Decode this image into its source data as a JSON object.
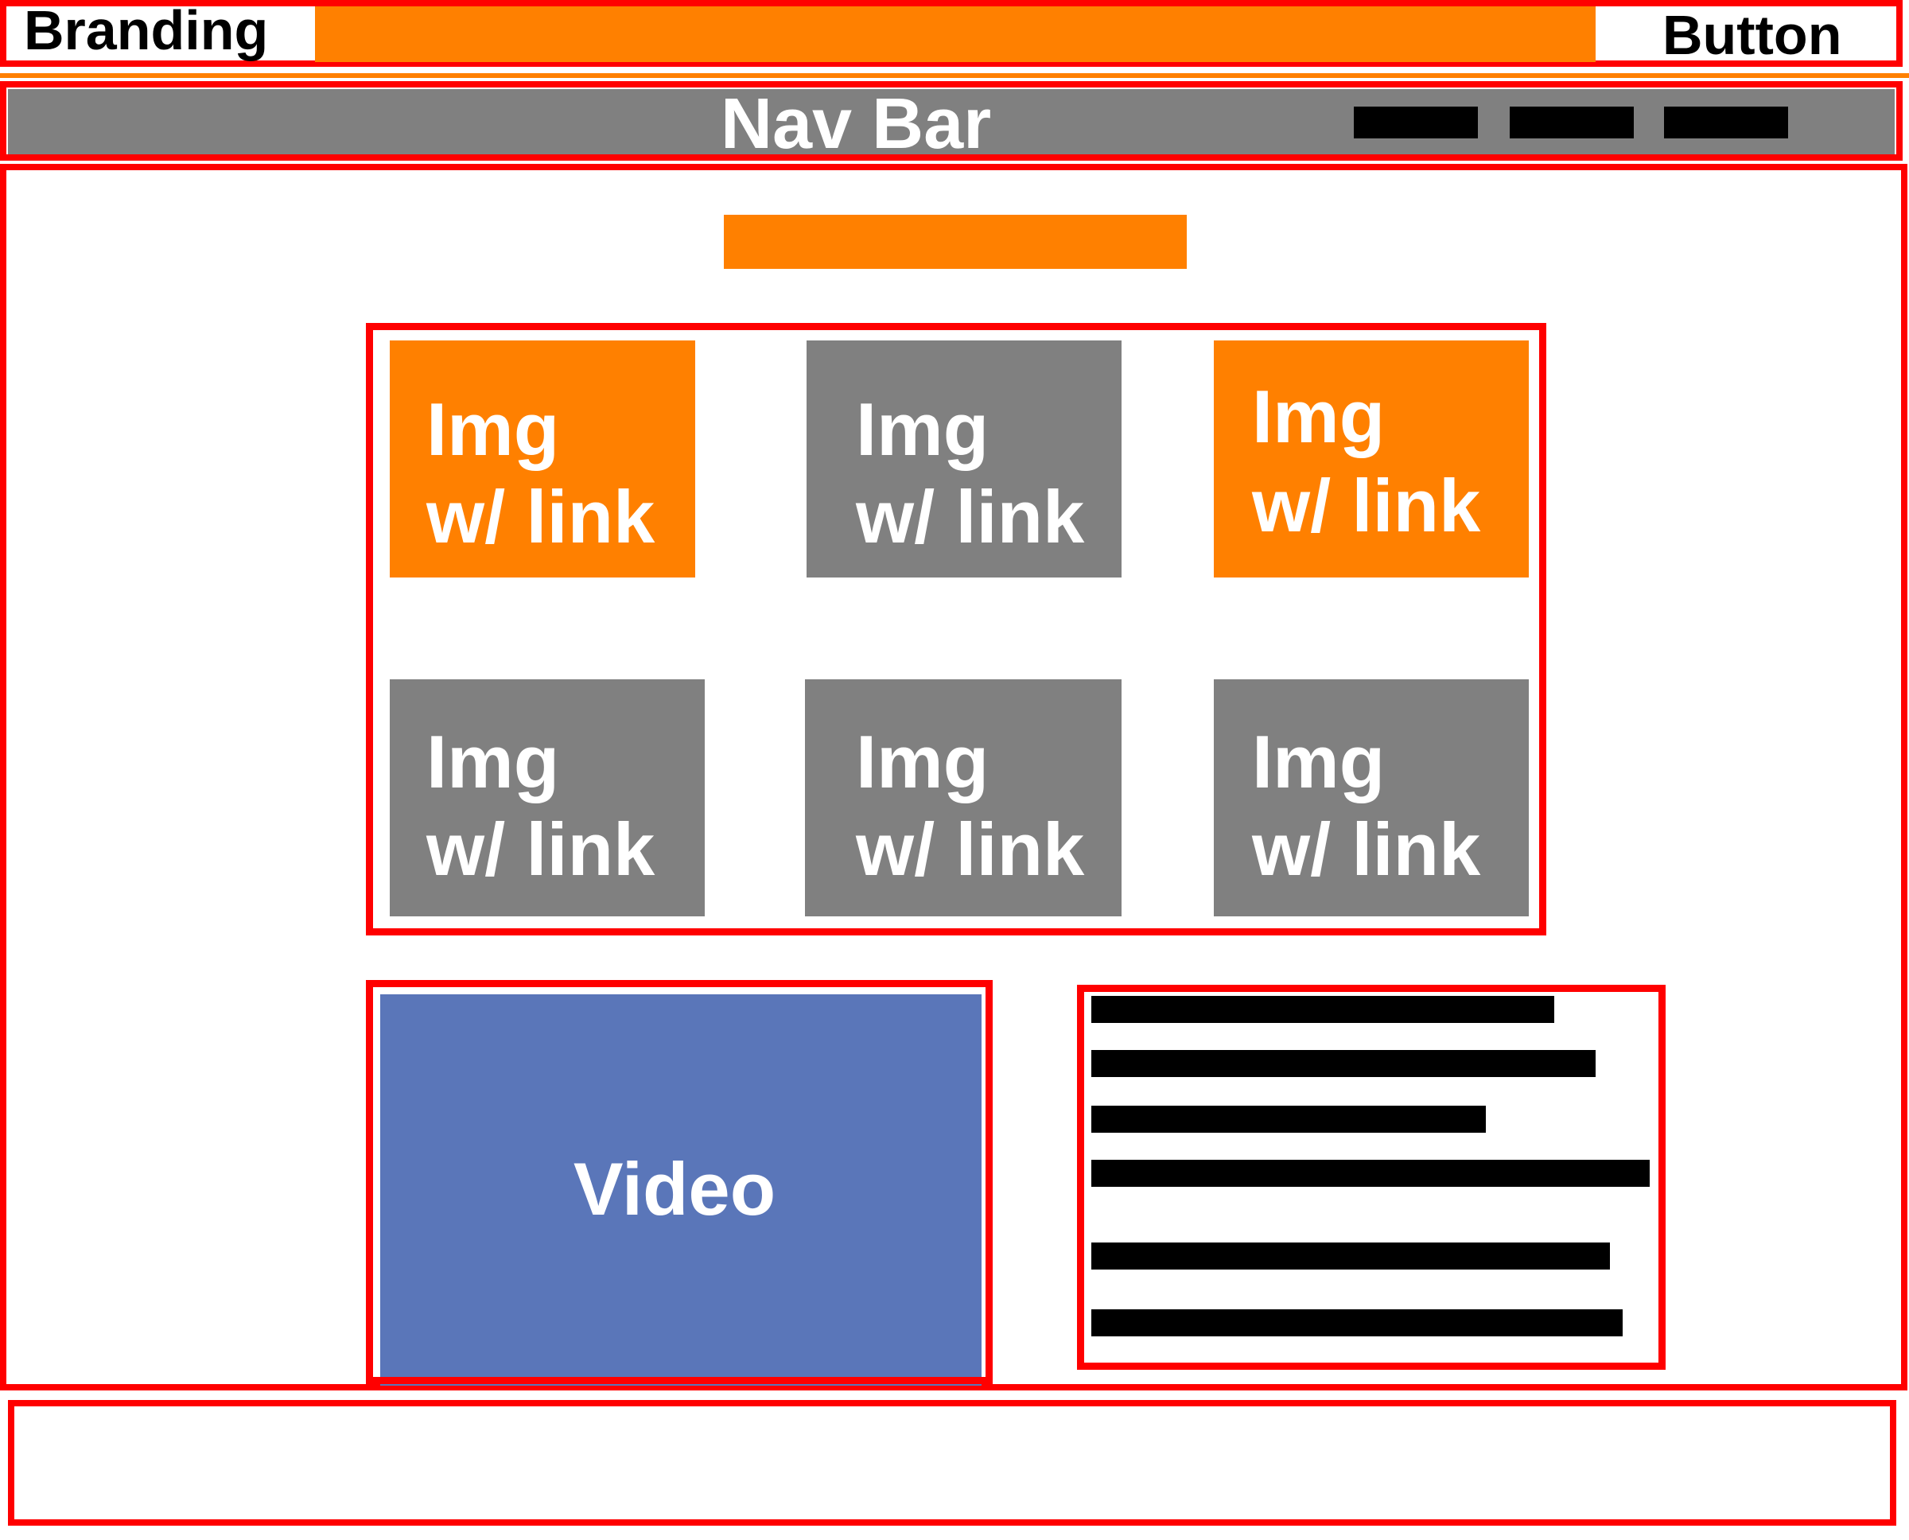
{
  "header": {
    "branding": "Branding",
    "button_label": "Button"
  },
  "nav": {
    "title": "Nav Bar",
    "item_count": 3
  },
  "grid": {
    "tiles": [
      {
        "label_line1": "Img",
        "label_line2": "w/ link",
        "color": "#ff8000"
      },
      {
        "label_line1": "Img",
        "label_line2": "w/ link",
        "color": "#808080"
      },
      {
        "label_line1": "Img",
        "label_line2": "w/ link",
        "color": "#ff8000"
      },
      {
        "label_line1": "Img",
        "label_line2": "w/ link",
        "color": "#808080"
      },
      {
        "label_line1": "Img",
        "label_line2": "w/ link",
        "color": "#808080"
      },
      {
        "label_line1": "Img",
        "label_line2": "w/ link",
        "color": "#808080"
      }
    ]
  },
  "video": {
    "label": "Video",
    "color": "#5a76b9"
  },
  "text_block": {
    "line_count": 6
  },
  "colors": {
    "outline": "#ff0000",
    "accent": "#ff8000",
    "nav": "#808080",
    "text_placeholder": "#000000"
  }
}
